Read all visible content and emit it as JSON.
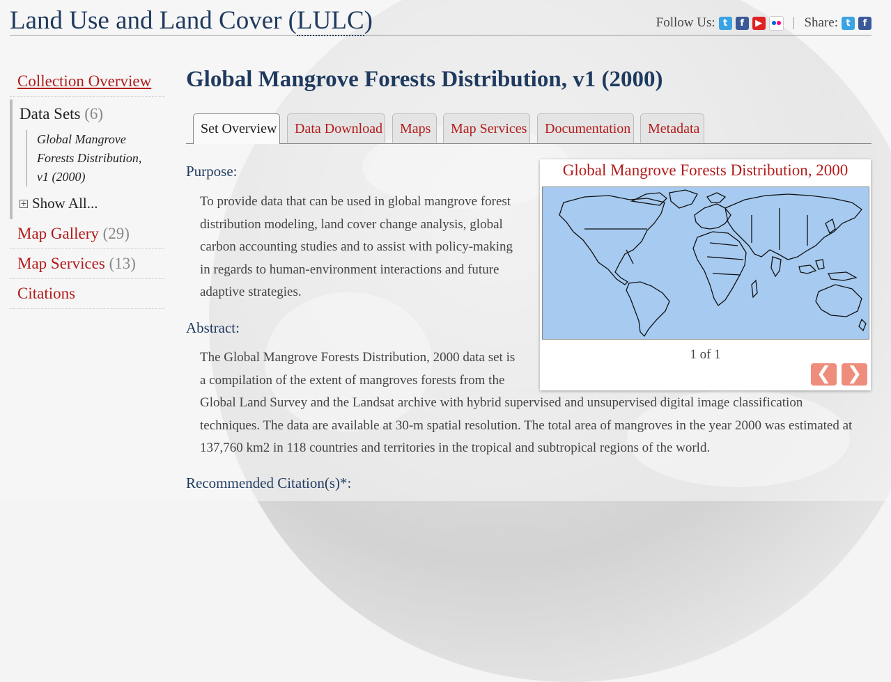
{
  "header": {
    "title_main": "Land Use and Land Cover (",
    "title_abbr": "LULC",
    "title_close": ")",
    "follow_label": "Follow Us:",
    "share_label": "Share:",
    "separator": "|",
    "follow_icons": [
      "twitter-icon",
      "facebook-icon",
      "youtube-icon",
      "flickr-icon"
    ],
    "share_icons": [
      "twitter-icon",
      "facebook-icon"
    ]
  },
  "sidebar": {
    "collection_overview": "Collection Overview",
    "datasets_label": "Data Sets",
    "datasets_count": "(6)",
    "current_dataset": [
      "Global Mangrove",
      "Forests Distribution,",
      "v1 (2000)"
    ],
    "show_all": "Show All...",
    "map_gallery": "Map Gallery",
    "map_gallery_count": "(29)",
    "map_services": "Map Services",
    "map_services_count": "(13)",
    "citations": "Citations"
  },
  "main": {
    "page_title": "Global Mangrove Forests Distribution, v1 (2000)",
    "tabs": [
      "Set Overview",
      "Data Download",
      "Maps",
      "Map Services",
      "Documentation",
      "Metadata"
    ],
    "active_tab": "Set Overview",
    "purpose_heading": "Purpose:",
    "purpose_lines": [
      "To provide data that can be used in global mangrove forest",
      "distribution modeling, land cover change analysis, global",
      "carbon accounting studies and to assist with policy-making",
      "in regards to human-environment interactions and future",
      "adaptive strategies."
    ],
    "abstract_heading": "Abstract:",
    "abstract_lines": [
      "The Global Mangrove Forests Distribution, 2000 data set is",
      "a compilation of the extent of mangroves forests from the",
      "Global Land Survey and the Landsat archive with hybrid supervised and unsupervised digital image classification",
      "techniques. The data are available at 30-m spatial resolution. The total area of mangroves in the year 2000 was estimated at",
      "137,760 km2 in 118 countries and territories in the tropical and subtropical regions of the world."
    ],
    "citation_heading": "Recommended Citation(s)*:"
  },
  "map_card": {
    "title": "Global Mangrove Forests Distribution, 2000",
    "counter": "1 of 1",
    "prev_glyph": "❮",
    "next_glyph": "❯",
    "ocean_color": "#a6caf0",
    "land_outline_color": "#111111"
  },
  "colors": {
    "heading_blue": "#1f3a5f",
    "link_red": "#b31b1b",
    "arrow_salmon": "#ef8d7c"
  }
}
